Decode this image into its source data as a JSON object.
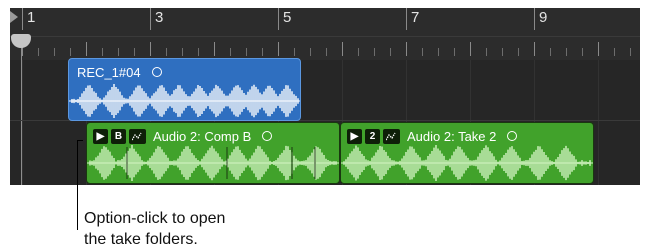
{
  "ruler": {
    "bars": [
      "1",
      "3",
      "5",
      "7",
      "9"
    ]
  },
  "regions": {
    "recording": {
      "title": "REC_1#04",
      "color": "#2f6fc0"
    },
    "take_b": {
      "play_chip": "▶",
      "take_chip": "B",
      "title": "Audio 2: Comp B",
      "color": "#41a22b"
    },
    "take_2": {
      "play_chip": "▶",
      "take_chip": "2",
      "title": "Audio 2: Take 2",
      "color": "#41a22b"
    }
  },
  "annotation": {
    "line1": "Option-click to open",
    "line2": "the take folders."
  }
}
